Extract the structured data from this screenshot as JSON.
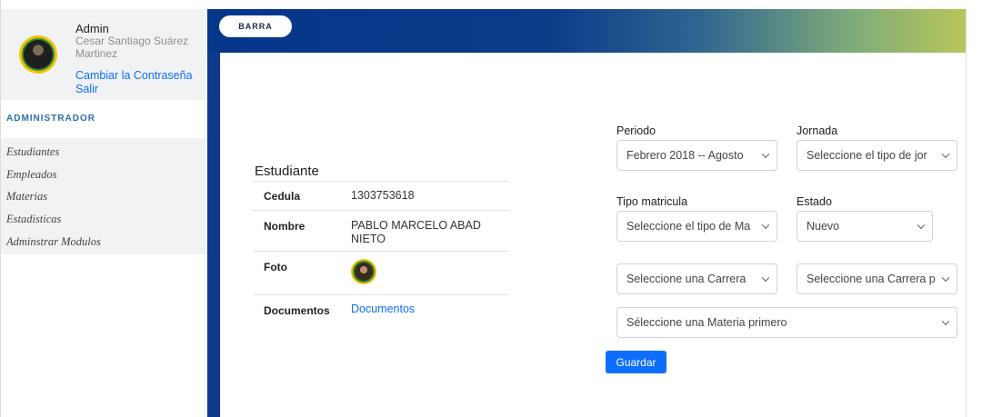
{
  "user": {
    "role": "Admin",
    "name": "Cesar Santiago Suárez Martinez",
    "change_password": "Cambiar la Contraseña",
    "logout": "Salir"
  },
  "sidebar": {
    "section_title": "ADMINISTRADOR",
    "items": [
      {
        "label": "Estudiantes"
      },
      {
        "label": "Empleados"
      },
      {
        "label": "Materias"
      },
      {
        "label": "Estadisticas"
      },
      {
        "label": "Adminstrar Modulos"
      }
    ]
  },
  "topbar": {
    "button_label": "BARRA",
    "gradient_colors": [
      "#05368a",
      "#b9c65a"
    ]
  },
  "student": {
    "title": "Estudiante",
    "rows": [
      {
        "key": "Cedula",
        "value": "1303753618"
      },
      {
        "key": "Nombre",
        "value": "PABLO MARCELO ABAD NIETO"
      },
      {
        "key": "Foto",
        "value": ""
      },
      {
        "key": "Documentos",
        "value": "Documentos"
      }
    ]
  },
  "form": {
    "periodo_label": "Periodo",
    "periodo_value": "Febrero 2018 -- Agosto",
    "jornada_label": "Jornada",
    "jornada_value": "Seleccione el tipo de jor",
    "tipo_label": "Tipo matricula",
    "tipo_value": "Seleccione el tipo de Ma",
    "estado_label": "Estado",
    "estado_value": "Nuevo",
    "carrera_value": "Seleccione una Carrera",
    "carrera2_value": "Seleccione una Carrera p",
    "materia_value": "Séleccione una Materia primero",
    "save_label": "Guardar"
  },
  "colors": {
    "accent": "#0d6efd",
    "sidebar_divider": "#0d3a8a",
    "section_title": "#2a6fb0"
  }
}
